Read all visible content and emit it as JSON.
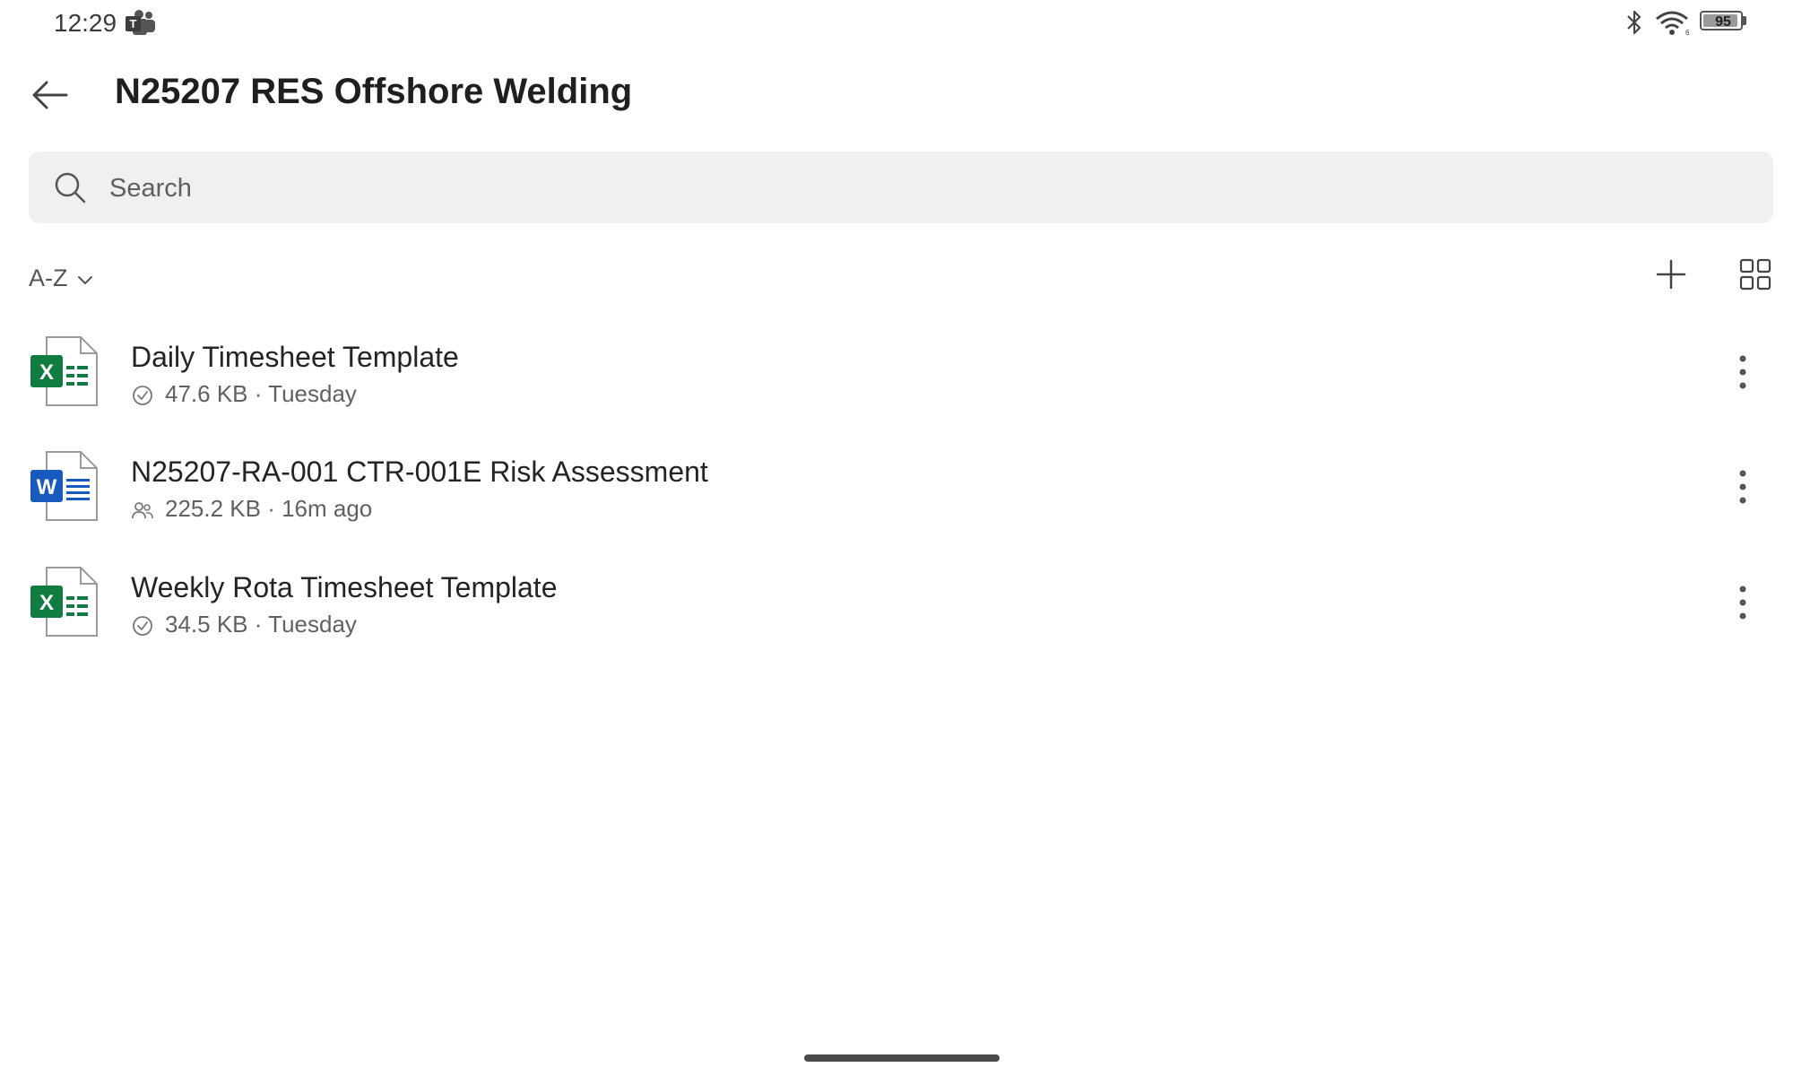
{
  "status_bar": {
    "time": "12:29",
    "battery_level": "95",
    "icons": [
      "teams-icon",
      "bluetooth-icon",
      "wifi-icon",
      "battery-icon"
    ]
  },
  "header": {
    "title": "N25207 RES Offshore Welding",
    "back_icon": "arrow-left-icon"
  },
  "search": {
    "placeholder": "Search",
    "value": ""
  },
  "toolbar": {
    "sort_label": "A-Z",
    "add_icon": "plus-icon",
    "view_icon": "grid-view-icon"
  },
  "files": [
    {
      "name": "Daily Timesheet Template",
      "meta": "47.6 KB · Tuesday",
      "type": "excel",
      "status_icon": "synced-check-icon"
    },
    {
      "name": "N25207-RA-001 CTR-001E Risk Assessment",
      "meta": "225.2 KB · 16m ago",
      "type": "word",
      "status_icon": "shared-people-icon"
    },
    {
      "name": "Weekly Rota Timesheet Template",
      "meta": "34.5 KB · Tuesday",
      "type": "excel",
      "status_icon": "synced-check-icon"
    }
  ],
  "colors": {
    "excel": "#107C41",
    "word": "#185ABD",
    "search_bg": "#f0f0f0",
    "text_primary": "#242424",
    "text_secondary": "#616161"
  }
}
